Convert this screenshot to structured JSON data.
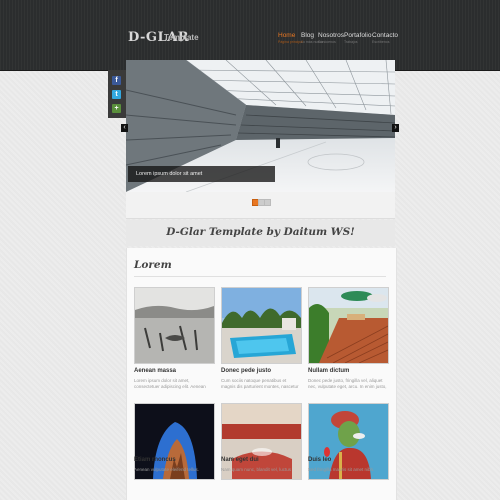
{
  "header": {
    "logo": "D-GLAR",
    "logo_sub": "Template",
    "nav": [
      {
        "label": "Home",
        "sub": "Página principal"
      },
      {
        "label": "Blog",
        "sub": "Lo más nuevo"
      },
      {
        "label": "Nosotros",
        "sub": "Conócenos"
      },
      {
        "label": "Portafolio",
        "sub": "Trabajos"
      },
      {
        "label": "Contacto",
        "sub": "Escríbenos"
      }
    ]
  },
  "social": [
    "facebook-icon",
    "twitter-icon",
    "plus-icon"
  ],
  "slider": {
    "caption": "Lorem ipsum dolor sit amet",
    "prev": "‹",
    "next": "›"
  },
  "tagline": "D-Glar Template by Daitum WS!",
  "section": {
    "title": "Lorem",
    "cards": [
      {
        "title": "Aenean massa",
        "desc": "Lorem ipsum dolor sit amet, consectetuer adipiscing elit. Aenean commodo ligula eget dolor."
      },
      {
        "title": "Donec pede justo",
        "desc": "Cum sociis natoque penatibus et magnis dis parturient montes, nascetur ridiculus mus. Donec quam felis, ultricies nec."
      },
      {
        "title": "Nullam dictum",
        "desc": "Donec pede justo, fringilla vel, aliquet nec, vulputate eget, arcu. In enim justo, rhoncus ut. Nullam dictum felis eu pede."
      },
      {
        "title": "Etiam rhoncus",
        "desc": "Aenean vulputate eleifend tellus. Aenean leo ligula, porttitor eu."
      },
      {
        "title": "Nam eget dui",
        "desc": "Nam quam nunc, blandit vel, luctus pulvinar, hendrerit id, lorem. Viverra"
      },
      {
        "title": "Duis leo",
        "desc": "Sed fringilla mauris sit amet nibh. Donec sodales sagittis magna."
      }
    ]
  },
  "colors": {
    "accent": "#e87722",
    "header": "#2b2d2e"
  }
}
